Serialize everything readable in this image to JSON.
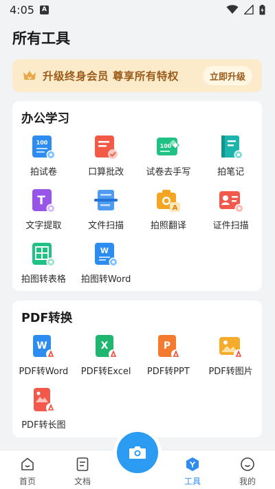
{
  "status_bar": {
    "time": "4:05",
    "app_icon": "A"
  },
  "page_title": "所有工具",
  "vip_banner": {
    "text": "升级终身会员 尊享所有特权",
    "button": "立即升级"
  },
  "sections": [
    {
      "title": "办公学习",
      "tools": [
        {
          "label": "拍试卷",
          "icon": "exam-photo-icon"
        },
        {
          "label": "口算批改",
          "icon": "math-check-icon"
        },
        {
          "label": "试卷去手写",
          "icon": "erase-handwriting-icon"
        },
        {
          "label": "拍笔记",
          "icon": "note-photo-icon"
        },
        {
          "label": "文字提取",
          "icon": "text-extract-icon"
        },
        {
          "label": "文件扫描",
          "icon": "file-scan-icon"
        },
        {
          "label": "拍照翻译",
          "icon": "photo-translate-icon"
        },
        {
          "label": "证件扫描",
          "icon": "id-scan-icon"
        },
        {
          "label": "拍图转表格",
          "icon": "image-to-table-icon"
        },
        {
          "label": "拍图转Word",
          "icon": "image-to-word-icon"
        }
      ]
    },
    {
      "title": "PDF转换",
      "tools": [
        {
          "label": "PDF转Word",
          "icon": "pdf-to-word-icon"
        },
        {
          "label": "PDF转Excel",
          "icon": "pdf-to-excel-icon"
        },
        {
          "label": "PDF转PPT",
          "icon": "pdf-to-ppt-icon"
        },
        {
          "label": "PDF转图片",
          "icon": "pdf-to-image-icon"
        },
        {
          "label": "PDF转长图",
          "icon": "pdf-to-long-image-icon"
        }
      ]
    }
  ],
  "bottom_nav": {
    "items": [
      {
        "label": "首页",
        "icon": "home-icon",
        "active": false
      },
      {
        "label": "文档",
        "icon": "document-icon",
        "active": false
      },
      {
        "label": "工具",
        "icon": "tools-icon",
        "active": true
      },
      {
        "label": "我的",
        "icon": "profile-icon",
        "active": false
      }
    ],
    "camera_icon": "camera-icon"
  },
  "colors": {
    "accent": "#2B9CF2",
    "vip_bg": "#FCEBCB",
    "vip_text": "#9B5A18",
    "nav_active": "#2D8CF0"
  }
}
